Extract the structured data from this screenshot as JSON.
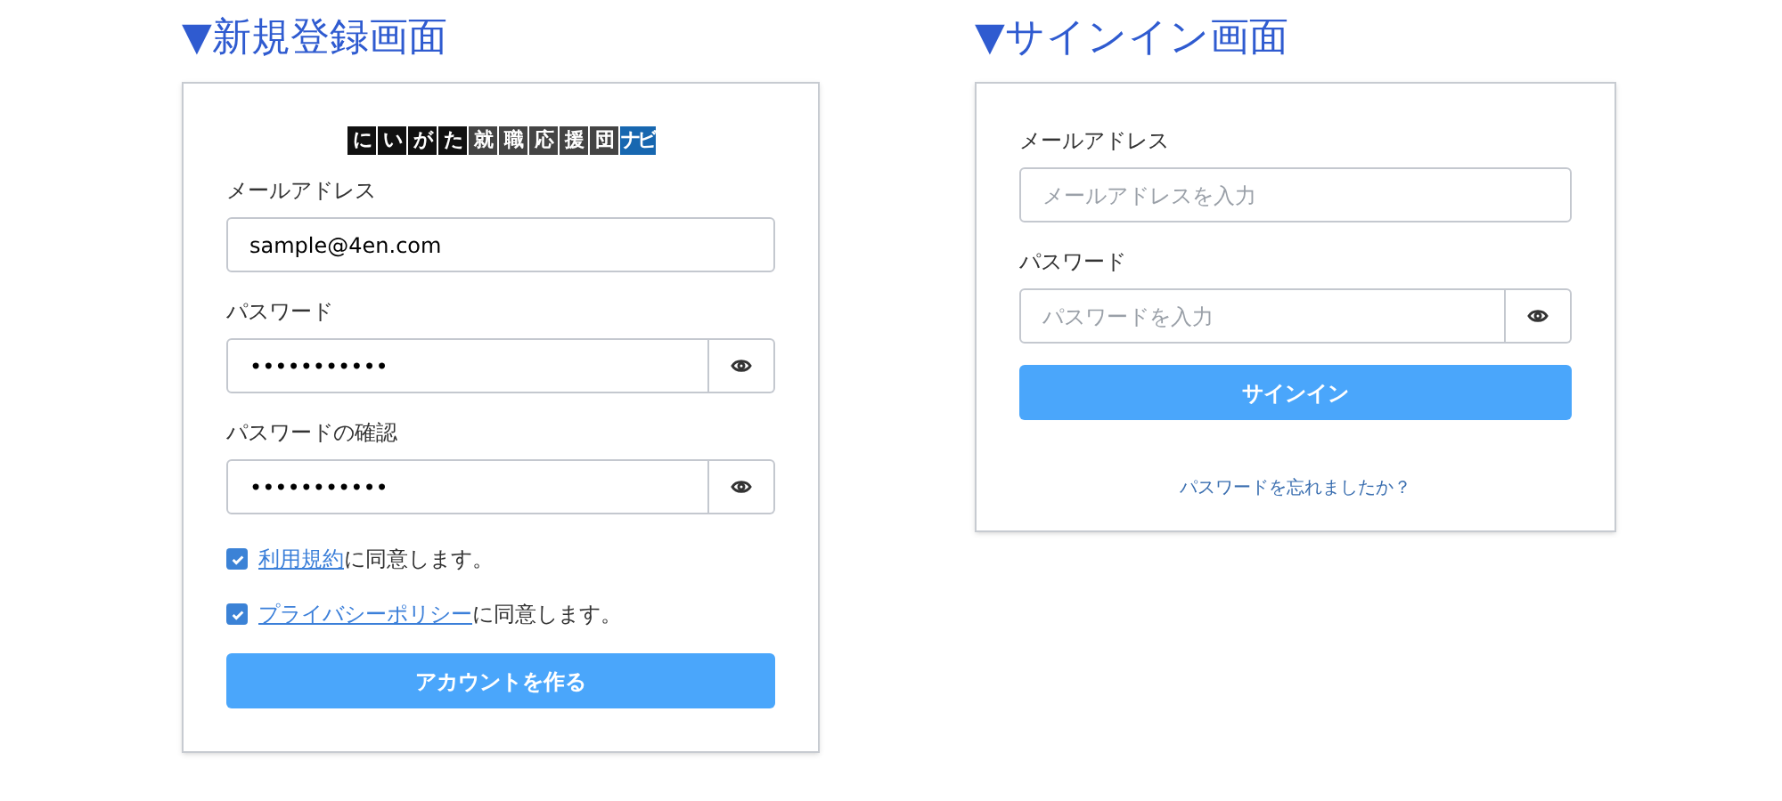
{
  "screens": [
    {
      "heading": "▼新規登録画面",
      "logo": [
        {
          "text": "に",
          "color": "#111111"
        },
        {
          "text": "い",
          "color": "#111111"
        },
        {
          "text": "が",
          "color": "#111111"
        },
        {
          "text": "た",
          "color": "#111111"
        },
        {
          "text": "就",
          "color": "#444444"
        },
        {
          "text": "職",
          "color": "#444444"
        },
        {
          "text": "応",
          "color": "#444444"
        },
        {
          "text": "援",
          "color": "#444444"
        },
        {
          "text": "団",
          "color": "#444444"
        },
        {
          "text": "ナビ",
          "color": "#1767b0"
        }
      ],
      "fields": [
        {
          "label": "メールアドレス",
          "kind": "text",
          "value": "sample@4en.com"
        },
        {
          "label": "パスワード",
          "kind": "password",
          "value": "•••••••••••"
        },
        {
          "label": "パスワードの確認",
          "kind": "password",
          "value": "•••••••••••"
        }
      ],
      "agreements": [
        {
          "link": "利用規約",
          "text": "に同意します。",
          "checked": true
        },
        {
          "link": "プライバシーポリシー",
          "text": "に同意します。",
          "checked": true
        }
      ],
      "submit": "アカウントを作る"
    },
    {
      "heading": "▼サインイン画面",
      "fields": [
        {
          "label": "メールアドレス",
          "kind": "text",
          "placeholder": "メールアドレスを入力"
        },
        {
          "label": "パスワード",
          "kind": "password",
          "placeholder": "パスワードを入力"
        }
      ],
      "submit": "サインイン",
      "forgot_link": "パスワードを忘れましたか？"
    }
  ]
}
